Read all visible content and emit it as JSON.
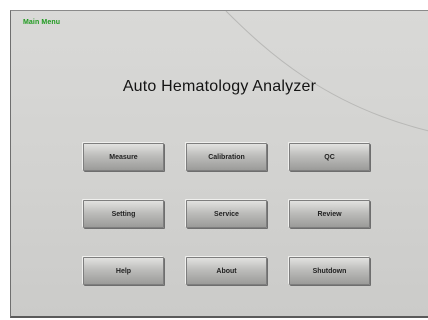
{
  "screen": {
    "menu_title": "Main Menu",
    "app_title": "Auto Hematology Analyzer"
  },
  "buttons": [
    {
      "label": "Measure"
    },
    {
      "label": "Calibration"
    },
    {
      "label": "QC"
    },
    {
      "label": "Setting"
    },
    {
      "label": "Service"
    },
    {
      "label": "Review"
    },
    {
      "label": "Help"
    },
    {
      "label": "About"
    },
    {
      "label": "Shutdown"
    }
  ],
  "colors": {
    "menu_title": "#1f9a1f",
    "background": "#d4d4d2",
    "button_face": "#bdbdbb"
  }
}
